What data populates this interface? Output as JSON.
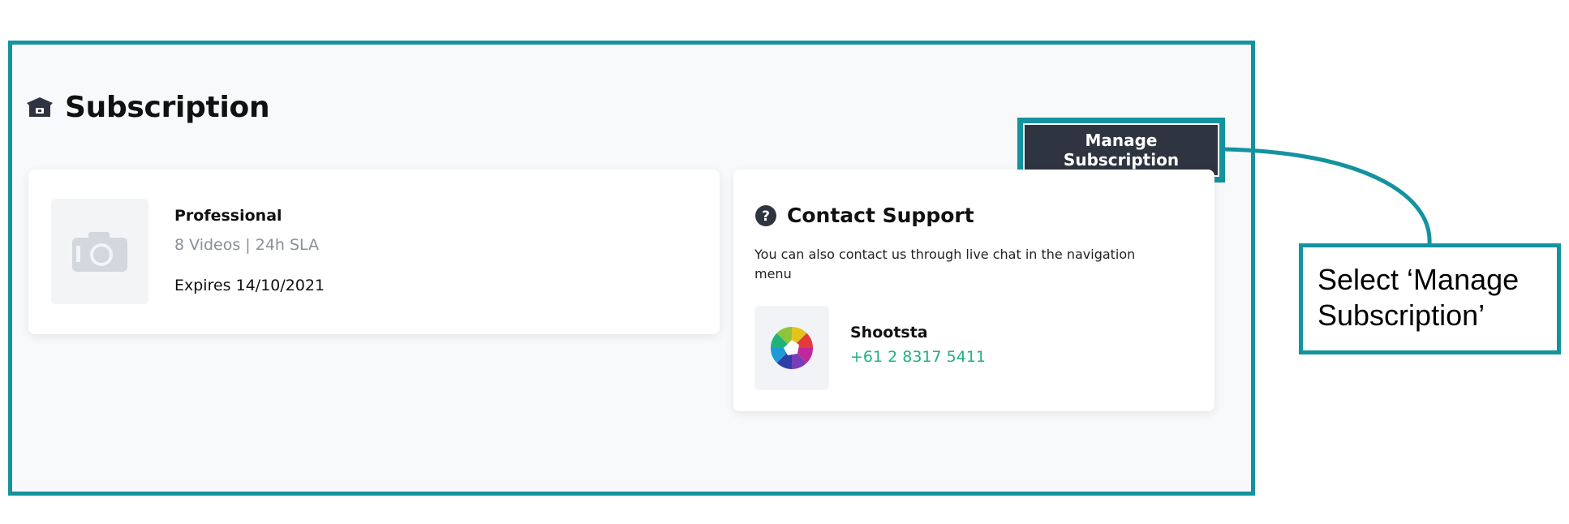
{
  "subscription": {
    "title": "Subscription",
    "manage_label": "Manage Subscription"
  },
  "plan": {
    "name": "Professional",
    "details": "8 Videos | 24h SLA",
    "expires": "Expires 14/10/2021",
    "thumbnail_icon": "camera-icon"
  },
  "support": {
    "title": "Contact Support",
    "description": "You can also contact us through live chat in the navigation menu",
    "contact_name": "Shootsta",
    "contact_phone": "+61 2 8317 5411",
    "logo_icon": "shootsta-logo"
  },
  "annotation": {
    "text": "Select ‘Manage Subscription’"
  },
  "colors": {
    "annotation_accent": "#14939e",
    "button_bg": "#2f3540",
    "phone": "#22b07d"
  }
}
